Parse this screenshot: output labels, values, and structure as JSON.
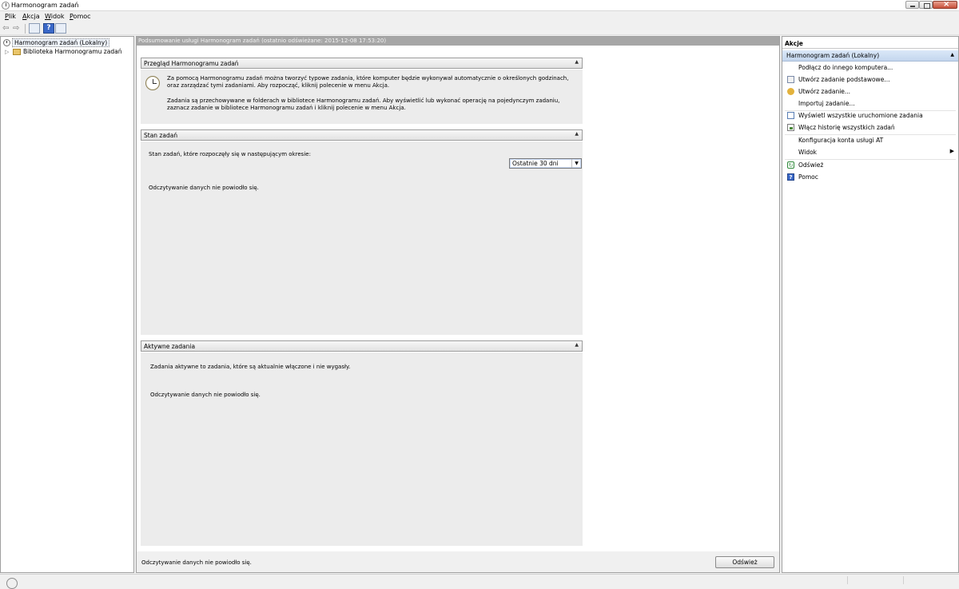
{
  "window": {
    "title": "Harmonogram zadań"
  },
  "menu": {
    "items": [
      {
        "accel": "P",
        "rest": "lik"
      },
      {
        "accel": "A",
        "rest": "kcja"
      },
      {
        "accel": "W",
        "rest": "idok"
      },
      {
        "accel": "P",
        "rest": "omoc"
      }
    ]
  },
  "toolbar": {
    "back_icon": "back-arrow-icon",
    "forward_icon": "forward-arrow-icon",
    "help_glyph": "?"
  },
  "tree": {
    "root": "Harmonogram zadań (Lokalny)",
    "child": "Biblioteka Harmonogramu zadań"
  },
  "center": {
    "header": "Podsumowanie usługi Harmonogram zadań (ostatnio odświeżane: 2015-12-08 17:53:20)",
    "overview": {
      "title": "Przegląd Harmonogramu zadań",
      "para1": "Za pomocą Harmonogramu zadań można tworzyć typowe zadania, które komputer będzie wykonywał automatycznie o określonych godzinach, oraz zarządzać tymi zadaniami. Aby rozpocząć, kliknij polecenie w menu Akcja.",
      "para2": "Zadania są przechowywane w folderach w bibliotece Harmonogramu zadań. Aby wyświetlić lub wykonać operację na pojedynczym zadaniu, zaznacz zadanie w bibliotece Harmonogramu zadań i kliknij polecenie w menu Akcja."
    },
    "status": {
      "title": "Stan zadań",
      "period_label": "Stan zadań, które rozpoczęły się w następującym okresie:",
      "period_value": "Ostatnie 30 dni",
      "error": "Odczytywanie danych nie powiodło się."
    },
    "active": {
      "title": "Aktywne zadania",
      "description": "Zadania aktywne to zadania, które są aktualnie włączone i nie wygasły.",
      "error": "Odczytywanie danych nie powiodło się."
    },
    "footer": {
      "error": "Odczytywanie danych nie powiodło się.",
      "refresh_label": "Odśwież"
    }
  },
  "actions": {
    "header": "Akcje",
    "group": "Harmonogram zadań (Lokalny)",
    "items": [
      {
        "label": "Podłącz do innego komputera...",
        "icon": "none"
      },
      {
        "label": "Utwórz zadanie podstawowe...",
        "icon": "create-basic-task-icon"
      },
      {
        "label": "Utwórz zadanie...",
        "icon": "create-task-icon"
      },
      {
        "label": "Importuj zadanie...",
        "icon": "none"
      },
      {
        "label": "Wyświetl wszystkie uruchomione zadania",
        "icon": "running-tasks-icon"
      },
      {
        "label": "Włącz historię wszystkich zadań",
        "icon": "history-icon"
      },
      {
        "label": "Konfiguracja konta usługi AT",
        "icon": "none"
      },
      {
        "label": "Widok",
        "icon": "none",
        "submenu": "▶"
      },
      {
        "label": "Odśwież",
        "icon": "refresh-icon"
      },
      {
        "label": "Pomoc",
        "icon": "help-icon"
      }
    ]
  }
}
